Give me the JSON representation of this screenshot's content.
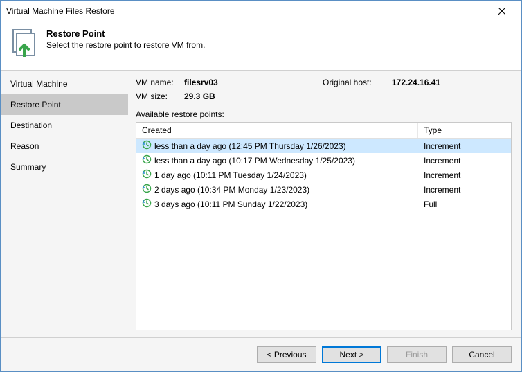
{
  "window": {
    "title": "Virtual Machine Files Restore"
  },
  "header": {
    "title": "Restore Point",
    "subtitle": "Select the restore point to restore VM from."
  },
  "sidebar": {
    "items": [
      {
        "label": "Virtual Machine",
        "active": false
      },
      {
        "label": "Restore Point",
        "active": true
      },
      {
        "label": "Destination",
        "active": false
      },
      {
        "label": "Reason",
        "active": false
      },
      {
        "label": "Summary",
        "active": false
      }
    ]
  },
  "info": {
    "vm_name_label": "VM name:",
    "vm_name_value": "filesrv03",
    "orig_host_label": "Original host:",
    "orig_host_value": "172.24.16.41",
    "vm_size_label": "VM size:",
    "vm_size_value": "29.3 GB"
  },
  "table": {
    "available_label": "Available restore points:",
    "columns": {
      "created": "Created",
      "type": "Type"
    },
    "rows": [
      {
        "created": "less than a day ago (12:45 PM Thursday 1/26/2023)",
        "type": "Increment",
        "selected": true
      },
      {
        "created": "less than a day ago (10:17 PM Wednesday 1/25/2023)",
        "type": "Increment",
        "selected": false
      },
      {
        "created": "1 day ago (10:11 PM Tuesday 1/24/2023)",
        "type": "Increment",
        "selected": false
      },
      {
        "created": "2 days ago (10:34 PM Monday 1/23/2023)",
        "type": "Increment",
        "selected": false
      },
      {
        "created": "3 days ago (10:11 PM Sunday 1/22/2023)",
        "type": "Full",
        "selected": false
      }
    ]
  },
  "buttons": {
    "previous": "< Previous",
    "next": "Next >",
    "finish": "Finish",
    "cancel": "Cancel"
  }
}
